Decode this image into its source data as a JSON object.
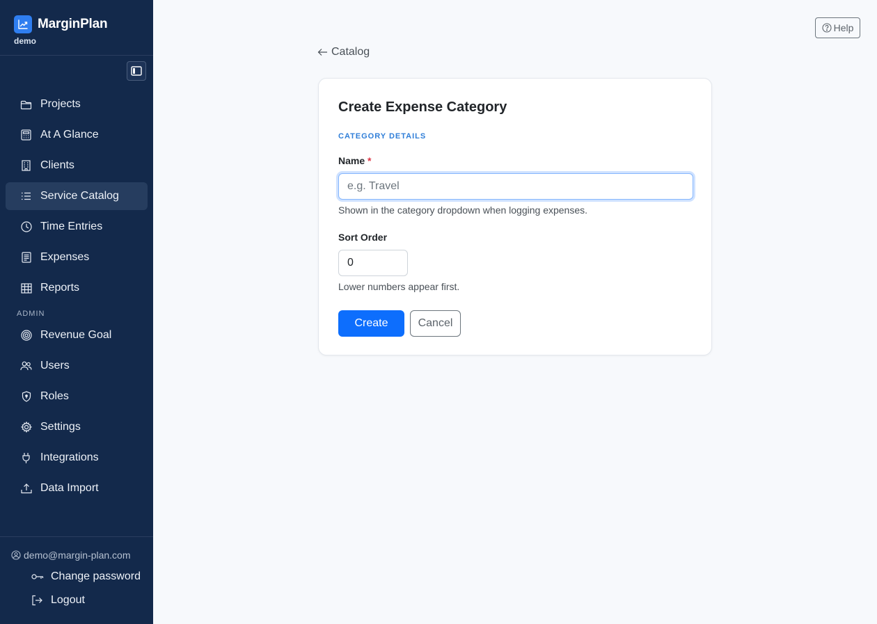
{
  "app": {
    "name": "MarginPlan",
    "org": "demo"
  },
  "sidebar": {
    "items": [
      {
        "label": "Projects",
        "icon": "folder-icon"
      },
      {
        "label": "At A Glance",
        "icon": "calculator-icon"
      },
      {
        "label": "Clients",
        "icon": "building-icon"
      },
      {
        "label": "Service Catalog",
        "icon": "list-icon",
        "active": true
      },
      {
        "label": "Time Entries",
        "icon": "clock-icon"
      },
      {
        "label": "Expenses",
        "icon": "receipt-icon"
      },
      {
        "label": "Reports",
        "icon": "table-icon"
      }
    ],
    "admin_label": "ADMIN",
    "admin_items": [
      {
        "label": "Revenue Goal",
        "icon": "target-icon"
      },
      {
        "label": "Users",
        "icon": "people-icon"
      },
      {
        "label": "Roles",
        "icon": "shield-icon"
      },
      {
        "label": "Settings",
        "icon": "gear-icon"
      },
      {
        "label": "Integrations",
        "icon": "plug-icon"
      },
      {
        "label": "Data Import",
        "icon": "upload-icon"
      }
    ],
    "user_email": "demo@margin-plan.com",
    "change_password": "Change password",
    "logout": "Logout"
  },
  "header": {
    "help": "Help"
  },
  "breadcrumb": {
    "back": "Catalog"
  },
  "form": {
    "title": "Create Expense Category",
    "section": "CATEGORY DETAILS",
    "name_label": "Name",
    "required_mark": "*",
    "name_value": "",
    "name_placeholder": "e.g. Travel",
    "name_help": "Shown in the category dropdown when logging expenses.",
    "sort_label": "Sort Order",
    "sort_value": "0",
    "sort_help": "Lower numbers appear first.",
    "create": "Create",
    "cancel": "Cancel"
  },
  "colors": {
    "sidebar": "#13294b",
    "accent": "#0d6efd",
    "section": "#2f7ed8"
  }
}
